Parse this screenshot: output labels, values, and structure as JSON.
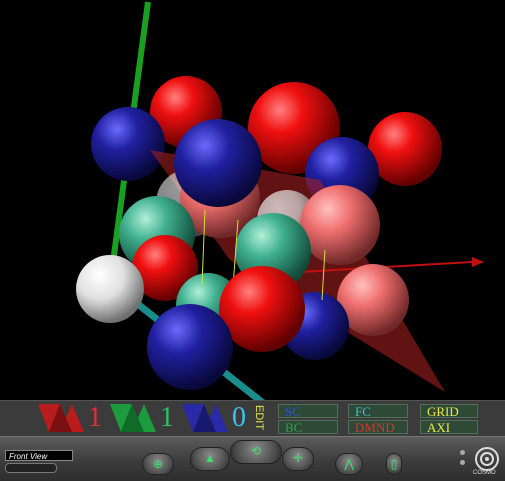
{
  "scene": {
    "description_free": true
  },
  "counters": [
    {
      "value": "1",
      "color": "#e03030",
      "icon": "red-triangles-icon"
    },
    {
      "value": "1",
      "color": "#30c060",
      "icon": "green-triangles-icon"
    },
    {
      "value": "0",
      "color": "#40c0f0",
      "icon": "blue-triangles-icon"
    }
  ],
  "edit_label": "EDIT",
  "buttons": {
    "sc": "SC",
    "bc": "BC",
    "fc": "FC",
    "dmnd": "DMND",
    "grid": "GRID",
    "axi": "AXI"
  },
  "button_colors": {
    "sc": "#3050e0",
    "bc": "#30a050",
    "fc": "#40c0d0",
    "dmnd": "#e03030",
    "grid": "#e8e84a",
    "axi": "#e8e84a"
  },
  "toolbar": {
    "viewpoint": "Front View",
    "brand": "COSMO"
  }
}
